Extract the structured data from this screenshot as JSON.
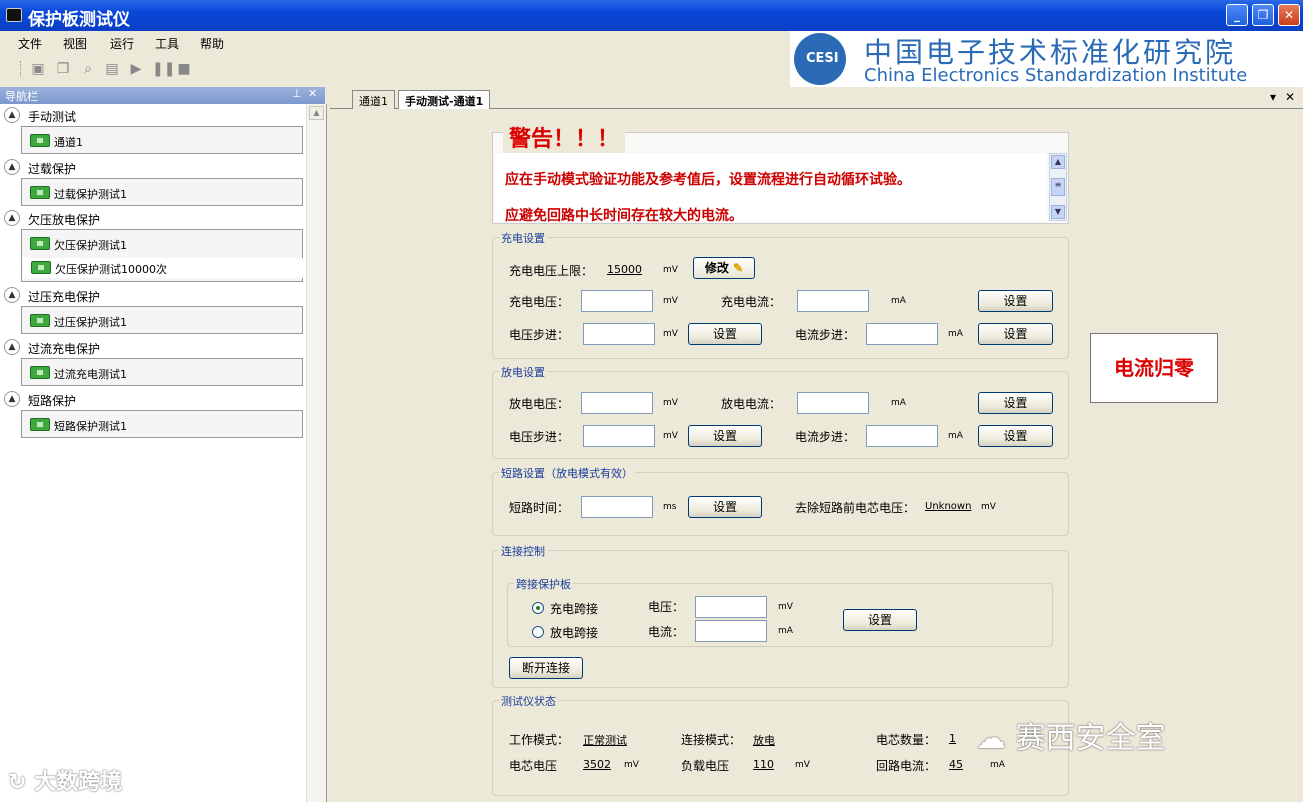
{
  "window": {
    "title": "保护板测试仪"
  },
  "menu": [
    "文件",
    "视图",
    "运行",
    "工具",
    "帮助"
  ],
  "logo": {
    "abbr": "CESI",
    "cn": "中国电子技术标准化研究院",
    "en": "China Electronics Standardization Institute"
  },
  "nav": {
    "title": "导航栏",
    "groups": [
      {
        "label": "手动测试",
        "items": [
          "通道1"
        ]
      },
      {
        "label": "过载保护",
        "items": [
          "过载保护测试1"
        ]
      },
      {
        "label": "欠压放电保护",
        "items": [
          "欠压保护测试1",
          "欠压保护测试10000次"
        ]
      },
      {
        "label": "过压充电保护",
        "items": [
          "过压保护测试1"
        ]
      },
      {
        "label": "过流充电保护",
        "items": [
          "过流充电测试1"
        ]
      },
      {
        "label": "短路保护",
        "items": [
          "短路保护测试1"
        ]
      }
    ]
  },
  "tabs": [
    "通道1",
    "手动测试-通道1"
  ],
  "warning": {
    "title": "警告！！！",
    "line1": "应在手动模式验证功能及参考值后，设置流程进行自动循环试验。",
    "line2": "应避免回路中长时间存在较大的电流。"
  },
  "charge": {
    "title": "充电设置",
    "limit_label": "充电电压上限：",
    "limit_value": "15000",
    "limit_unit": "mV",
    "modify": "修改",
    "v_label": "充电电压：",
    "v_unit": "mV",
    "i_label": "充电电流：",
    "i_unit": "mA",
    "vstep_label": "电压步进：",
    "vstep_unit": "mV",
    "istep_label": "电流步进：",
    "istep_unit": "mA",
    "set": "设置"
  },
  "discharge": {
    "title": "放电设置",
    "v_label": "放电电压：",
    "v_unit": "mV",
    "i_label": "放电电流：",
    "i_unit": "mA",
    "vstep_label": "电压步进：",
    "vstep_unit": "mV",
    "istep_label": "电流步进：",
    "istep_unit": "mA",
    "set": "设置"
  },
  "short": {
    "title": "短路设置（放电模式有效）",
    "time_label": "短路时间：",
    "time_unit": "ms",
    "set": "设置",
    "pre_label": "去除短路前电芯电压：",
    "pre_value": "Unknown",
    "pre_unit": "mV"
  },
  "connect": {
    "title": "连接控制",
    "sub_title": "跨接保护板",
    "opt1": "充电跨接",
    "opt2": "放电跨接",
    "v_label": "电压：",
    "v_unit": "mV",
    "i_label": "电流：",
    "i_unit": "mA",
    "set": "设置",
    "disconnect": "断开连接"
  },
  "status": {
    "title": "测试仪状态",
    "mode_label": "工作模式：",
    "mode_value": "正常测试",
    "conn_label": "连接模式：",
    "conn_value": "放电",
    "cells_label": "电芯数量：",
    "cells_value": "1",
    "cellv_label": "电芯电压",
    "cellv_value": "3502",
    "cellv_unit": "mV",
    "loadv_label": "负载电压",
    "loadv_value": "110",
    "loadv_unit": "mV",
    "loopi_label": "回路电流：",
    "loopi_value": "45",
    "loopi_unit": "mA"
  },
  "zero_button": "电流归零",
  "watermarks": {
    "left": "大数跨境",
    "right": "赛西安全室"
  }
}
